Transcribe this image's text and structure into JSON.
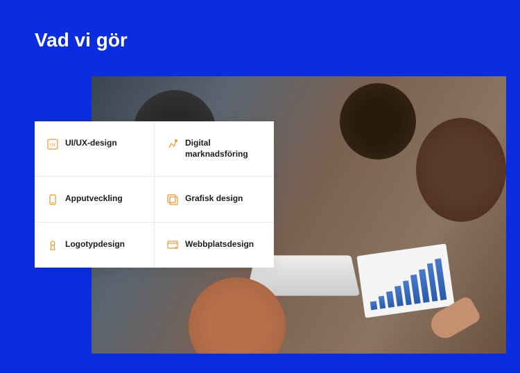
{
  "title": "Vad vi gör",
  "services": [
    [
      {
        "icon": "uiux-icon",
        "label": "UI/UX-design"
      },
      {
        "icon": "digital-icon",
        "label": "Digital marknadsföring"
      }
    ],
    [
      {
        "icon": "app-icon",
        "label": "Apputveckling"
      },
      {
        "icon": "graphic-icon",
        "label": "Grafisk design"
      }
    ],
    [
      {
        "icon": "logo-icon",
        "label": "Logotypdesign"
      },
      {
        "icon": "web-icon",
        "label": "Webbplatsdesign"
      }
    ]
  ],
  "colors": {
    "accent": "#f59428"
  }
}
